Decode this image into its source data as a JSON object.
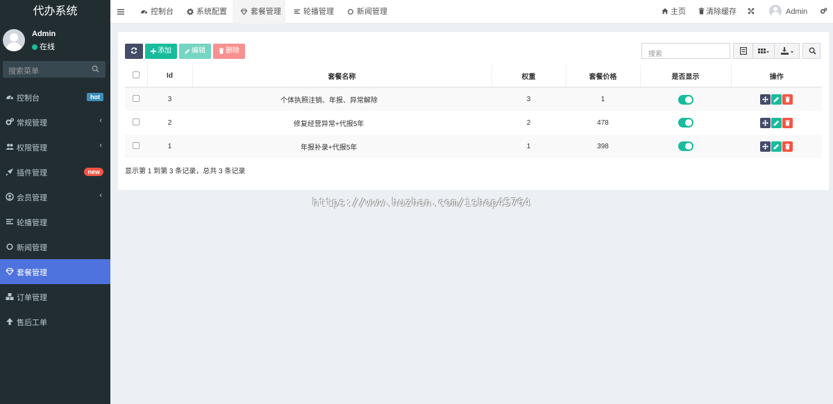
{
  "app": {
    "title": "代办系统"
  },
  "user": {
    "name": "Admin",
    "status": "在线"
  },
  "sidebar": {
    "search_placeholder": "搜索菜单",
    "items": [
      {
        "label": "控制台",
        "icon": "dashboard-icon",
        "badge": "hot"
      },
      {
        "label": "常规管理",
        "icon": "cogs-icon",
        "arrow": "‹"
      },
      {
        "label": "权限管理",
        "icon": "users-icon",
        "arrow": "‹"
      },
      {
        "label": "插件管理",
        "icon": "rocket-icon",
        "badge": "new"
      },
      {
        "label": "会员管理",
        "icon": "user-circle-icon",
        "arrow": "‹"
      },
      {
        "label": "轮播管理",
        "icon": "list-icon"
      },
      {
        "label": "新闻管理",
        "icon": "circle-icon"
      },
      {
        "label": "套餐管理",
        "icon": "diamond-icon",
        "active": true
      },
      {
        "label": "订单管理",
        "icon": "cubes-icon"
      },
      {
        "label": "售后工单",
        "icon": "arrow-up-icon"
      }
    ]
  },
  "topbar": {
    "tabs": [
      {
        "label": "控制台"
      },
      {
        "label": "系统配置"
      },
      {
        "label": "套餐管理"
      },
      {
        "label": "轮播管理"
      },
      {
        "label": "新闻管理"
      }
    ],
    "home_label": "主页",
    "clear_cache_label": "清除缓存",
    "user_label": "Admin"
  },
  "toolbar": {
    "add_label": "添加",
    "edit_label": "编辑",
    "delete_label": "删除",
    "search_placeholder": "搜索"
  },
  "table": {
    "columns": [
      "Id",
      "套餐名称",
      "权重",
      "套餐价格",
      "是否显示",
      "操作"
    ],
    "rows": [
      {
        "id": "3",
        "name": "个体执照注销、年报、异常解除",
        "weight": "3",
        "price": "1",
        "show": true
      },
      {
        "id": "2",
        "name": "修复经营异常+代报5年",
        "weight": "2",
        "price": "478",
        "show": true
      },
      {
        "id": "1",
        "name": "年报补录+代报5年",
        "weight": "1",
        "price": "398",
        "show": true
      }
    ],
    "footer": "显示第 1 到第 3 条记录，总共 3 条记录"
  },
  "watermark": "https://www.huzhan.com/ishop45764",
  "colors": {
    "sidebar_bg": "#222d32",
    "active_menu": "#4e73df",
    "refresh_btn": "#444c69",
    "add_btn": "#18bc9c",
    "edit_btn": "#74d5c2",
    "delete_btn": "#f89191",
    "toggle_on": "#18bc9c",
    "drag_btn": "#444c69",
    "edit_op": "#18bc9c",
    "delete_op": "#f75444"
  }
}
